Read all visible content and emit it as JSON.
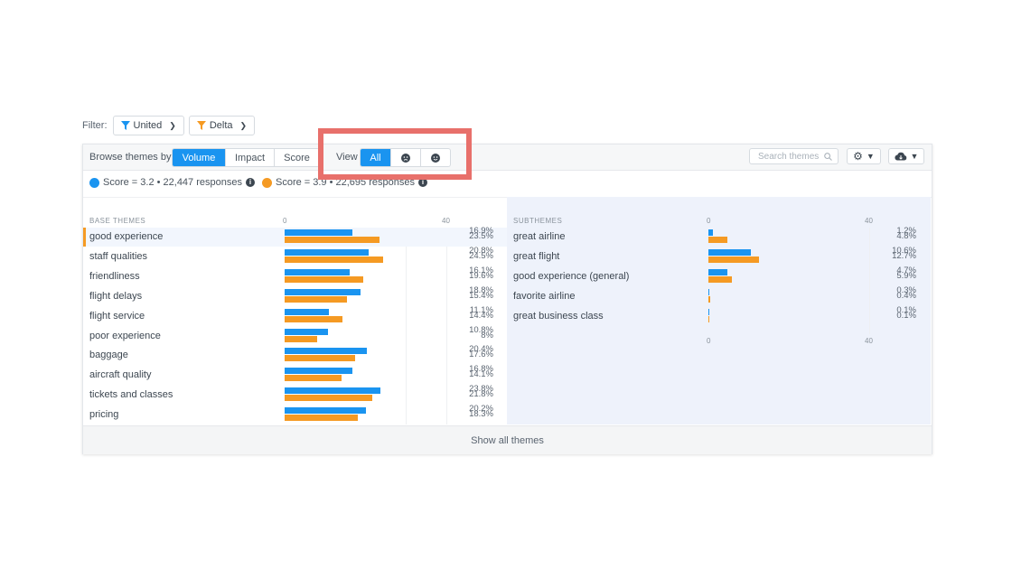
{
  "filter": {
    "label": "Filter:",
    "chips": [
      {
        "label": "United",
        "color": "#1a94f0"
      },
      {
        "label": "Delta",
        "color": "#f59a23"
      }
    ]
  },
  "toolbar": {
    "browse_label": "Browse themes by",
    "browse_options": [
      "Volume",
      "Impact",
      "Score"
    ],
    "browse_selected": "Volume",
    "view_label": "View",
    "view_options": [
      "All",
      "negative",
      "positive"
    ],
    "view_selected": "All",
    "search_placeholder": "Search themes",
    "settings_icon": "gear-icon",
    "download_icon": "cloud-download-icon"
  },
  "legend": {
    "series": [
      {
        "text": "Score = 3.2 • 22,447 responses",
        "color": "#1a94f0"
      },
      {
        "text": "Score = 3.9 • 22,695 responses",
        "color": "#f59a23"
      }
    ]
  },
  "base_themes": {
    "header": "BASE THEMES",
    "axis_ticks": [
      "0",
      "40"
    ],
    "rows": [
      {
        "label": "good experience",
        "a": "16.9%",
        "b": "23.5%",
        "va": 16.9,
        "vb": 23.5,
        "selected": true
      },
      {
        "label": "staff qualities",
        "a": "20.8%",
        "b": "24.5%",
        "va": 20.8,
        "vb": 24.5
      },
      {
        "label": "friendliness",
        "a": "16.1%",
        "b": "19.6%",
        "va": 16.1,
        "vb": 19.6
      },
      {
        "label": "flight delays",
        "a": "18.8%",
        "b": "15.4%",
        "va": 18.8,
        "vb": 15.4
      },
      {
        "label": "flight service",
        "a": "11.1%",
        "b": "14.4%",
        "va": 11.1,
        "vb": 14.4
      },
      {
        "label": "poor experience",
        "a": "10.8%",
        "b": "8%",
        "va": 10.8,
        "vb": 8
      },
      {
        "label": "baggage",
        "a": "20.4%",
        "b": "17.6%",
        "va": 20.4,
        "vb": 17.6
      },
      {
        "label": "aircraft quality",
        "a": "16.8%",
        "b": "14.1%",
        "va": 16.8,
        "vb": 14.1
      },
      {
        "label": "tickets and classes",
        "a": "23.8%",
        "b": "21.8%",
        "va": 23.8,
        "vb": 21.8
      },
      {
        "label": "pricing",
        "a": "20.2%",
        "b": "18.3%",
        "va": 20.2,
        "vb": 18.3
      }
    ]
  },
  "sub_themes": {
    "header": "SUBTHEMES",
    "axis_ticks": [
      "0",
      "40"
    ],
    "bottom_ticks": [
      "0",
      "40"
    ],
    "rows": [
      {
        "label": "great airline",
        "a": "1.2%",
        "b": "4.8%",
        "va": 1.2,
        "vb": 4.8
      },
      {
        "label": "great flight",
        "a": "10.6%",
        "b": "12.7%",
        "va": 10.6,
        "vb": 12.7
      },
      {
        "label": "good experience (general)",
        "a": "4.7%",
        "b": "5.9%",
        "va": 4.7,
        "vb": 5.9
      },
      {
        "label": "favorite airline",
        "a": "0.3%",
        "b": "0.4%",
        "va": 0.3,
        "vb": 0.4
      },
      {
        "label": "great business class",
        "a": "0.1%",
        "b": "0.1%",
        "va": 0.1,
        "vb": 0.1
      }
    ]
  },
  "footer": {
    "label": "Show all themes"
  },
  "colors": {
    "series_a": "#1a94f0",
    "series_b": "#f59a23",
    "highlight": "#e8706b"
  }
}
